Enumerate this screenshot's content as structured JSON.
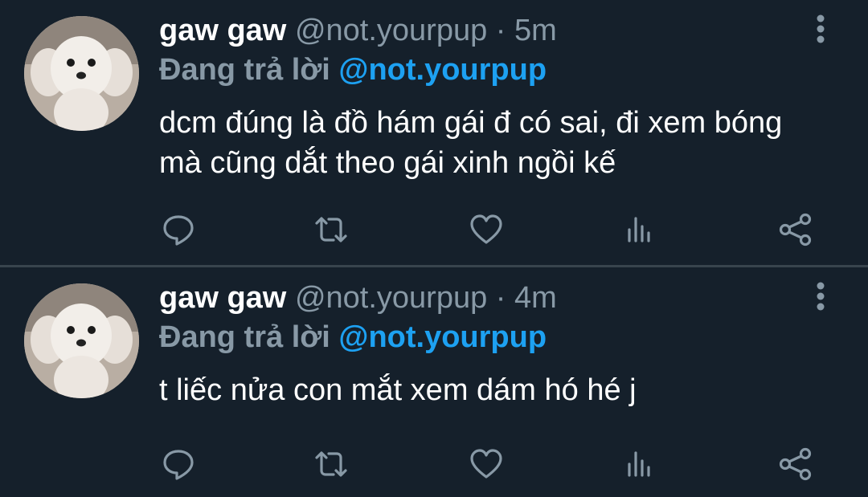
{
  "tweets": [
    {
      "author_name": "gaw gaw",
      "handle": "@not.yourpup",
      "separator": "·",
      "time": "5m",
      "reply_prefix": "Đang trả lời",
      "reply_target": "@not.yourpup",
      "text": "dcm đúng là đồ hám gái đ có sai, đi xem bóng mà cũng dắt theo gái xinh ngồi kế",
      "actions": [
        "reply-icon",
        "retweet-icon",
        "like-icon",
        "analytics-icon",
        "share-icon"
      ]
    },
    {
      "author_name": "gaw gaw",
      "handle": "@not.yourpup",
      "separator": "·",
      "time": "4m",
      "reply_prefix": "Đang trả lời",
      "reply_target": "@not.yourpup",
      "text": "t liếc nửa con mắt xem dám hó hé j",
      "actions": [
        "reply-icon",
        "retweet-icon",
        "like-icon",
        "analytics-icon",
        "share-icon"
      ]
    }
  ],
  "colors": {
    "background": "#15202b",
    "divider": "#38444d",
    "secondary_text": "#8899a6",
    "link": "#1da1f2",
    "primary_text": "#ffffff"
  }
}
